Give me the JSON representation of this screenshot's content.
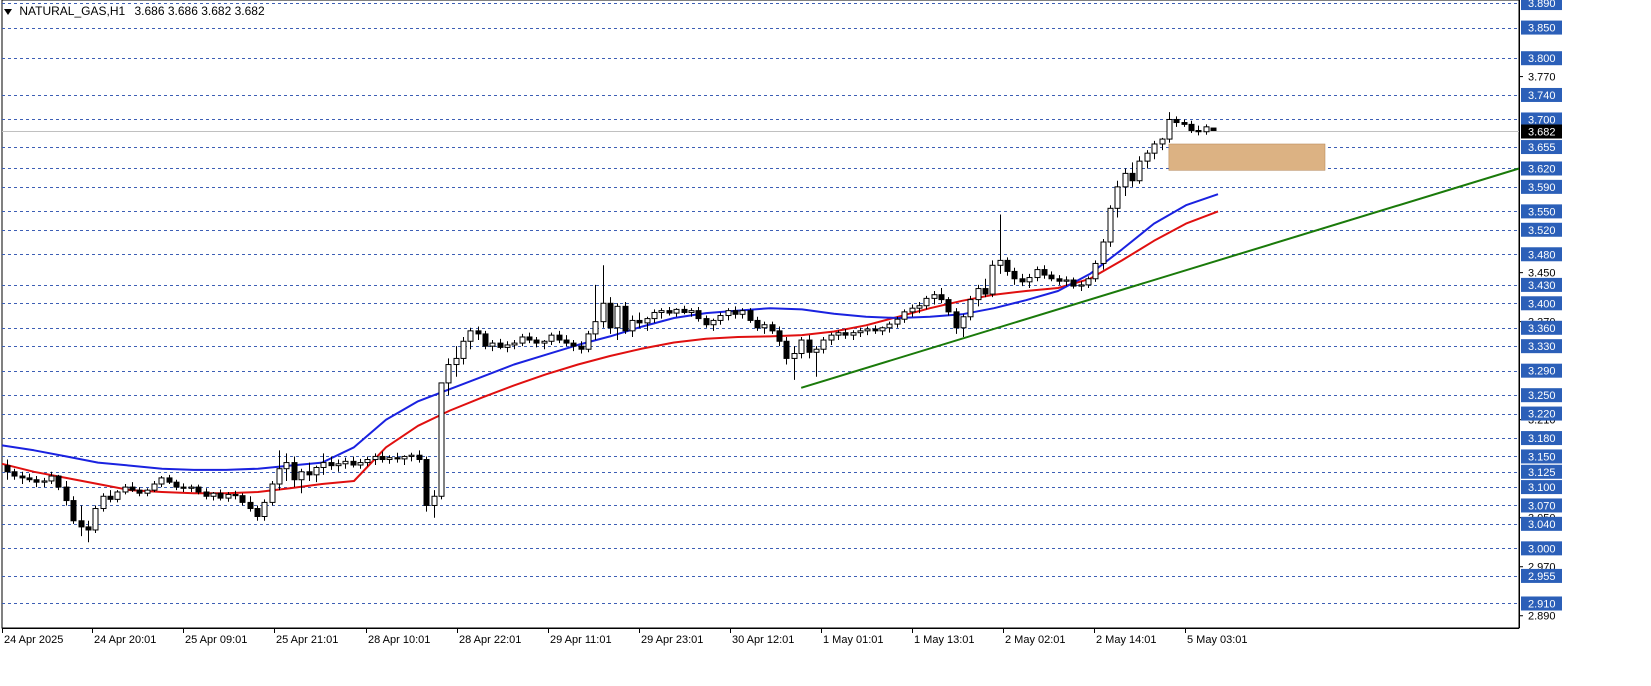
{
  "header": {
    "symbol": "NATURAL_GAS,H1",
    "ohlc": "3.686 3.686 3.682 3.682"
  },
  "colors": {
    "background": "#ffffff",
    "grid": "#3d5fb5",
    "ema_fast": "#1a22e0",
    "ema_slow": "#e01010",
    "trendline": "#1a7a0a",
    "zone": "#dcb283",
    "label_bg": "#2b5fb8",
    "current_bg": "#000000"
  },
  "chart_data": {
    "type": "candlestick",
    "ylim": [
      2.87,
      3.895
    ],
    "grid_levels": [
      3.89,
      3.85,
      3.8,
      3.74,
      3.7,
      3.655,
      3.62,
      3.59,
      3.55,
      3.52,
      3.48,
      3.43,
      3.4,
      3.36,
      3.33,
      3.29,
      3.25,
      3.22,
      3.18,
      3.15,
      3.125,
      3.1,
      3.07,
      3.04,
      3.0,
      2.955,
      2.91
    ],
    "axis_labels": [
      "3.770",
      "3.450",
      "3.370",
      "3.210",
      "3.050",
      "2.970",
      "2.890"
    ],
    "current_price": "3.682",
    "x_labels": [
      "24 Apr 2025",
      "24 Apr 20:01",
      "25 Apr 09:01",
      "25 Apr 21:01",
      "28 Apr 10:01",
      "28 Apr 22:01",
      "29 Apr 11:01",
      "29 Apr 23:01",
      "30 Apr 12:01",
      "1 May 01:01",
      "1 May 13:01",
      "2 May 02:01",
      "2 May 14:01",
      "5 May 03:01"
    ],
    "candles": [
      [
        3.135,
        3.145,
        3.112,
        3.125
      ],
      [
        3.125,
        3.13,
        3.112,
        3.118
      ],
      [
        3.118,
        3.125,
        3.105,
        3.115
      ],
      [
        3.115,
        3.122,
        3.108,
        3.112
      ],
      [
        3.112,
        3.118,
        3.1,
        3.108
      ],
      [
        3.108,
        3.115,
        3.1,
        3.11
      ],
      [
        3.11,
        3.125,
        3.105,
        3.118
      ],
      [
        3.118,
        3.12,
        3.095,
        3.1
      ],
      [
        3.1,
        3.11,
        3.07,
        3.078
      ],
      [
        3.078,
        3.085,
        3.04,
        3.045
      ],
      [
        3.045,
        3.07,
        3.02,
        3.035
      ],
      [
        3.035,
        3.045,
        3.01,
        3.03
      ],
      [
        3.03,
        3.07,
        3.025,
        3.065
      ],
      [
        3.065,
        3.09,
        3.06,
        3.085
      ],
      [
        3.085,
        3.095,
        3.075,
        3.08
      ],
      [
        3.08,
        3.095,
        3.075,
        3.092
      ],
      [
        3.092,
        3.105,
        3.088,
        3.1
      ],
      [
        3.1,
        3.108,
        3.092,
        3.095
      ],
      [
        3.095,
        3.1,
        3.085,
        3.09
      ],
      [
        3.09,
        3.098,
        3.085,
        3.095
      ],
      [
        3.095,
        3.11,
        3.092,
        3.105
      ],
      [
        3.105,
        3.118,
        3.1,
        3.115
      ],
      [
        3.115,
        3.12,
        3.105,
        3.108
      ],
      [
        3.108,
        3.112,
        3.095,
        3.1
      ],
      [
        3.1,
        3.106,
        3.092,
        3.098
      ],
      [
        3.098,
        3.104,
        3.092,
        3.1
      ],
      [
        3.1,
        3.104,
        3.088,
        3.092
      ],
      [
        3.092,
        3.098,
        3.08,
        3.085
      ],
      [
        3.085,
        3.092,
        3.078,
        3.09
      ],
      [
        3.09,
        3.096,
        3.078,
        3.082
      ],
      [
        3.082,
        3.092,
        3.076,
        3.088
      ],
      [
        3.088,
        3.094,
        3.08,
        3.086
      ],
      [
        3.086,
        3.09,
        3.07,
        3.075
      ],
      [
        3.075,
        3.085,
        3.06,
        3.065
      ],
      [
        3.065,
        3.07,
        3.045,
        3.052
      ],
      [
        3.052,
        3.08,
        3.045,
        3.075
      ],
      [
        3.075,
        3.11,
        3.07,
        3.105
      ],
      [
        3.105,
        3.16,
        3.095,
        3.13
      ],
      [
        3.13,
        3.155,
        3.11,
        3.14
      ],
      [
        3.14,
        3.15,
        3.1,
        3.112
      ],
      [
        3.112,
        3.13,
        3.09,
        3.125
      ],
      [
        3.125,
        3.14,
        3.11,
        3.12
      ],
      [
        3.12,
        3.135,
        3.108,
        3.132
      ],
      [
        3.132,
        3.155,
        3.12,
        3.14
      ],
      [
        3.14,
        3.15,
        3.128,
        3.135
      ],
      [
        3.135,
        3.145,
        3.125,
        3.138
      ],
      [
        3.138,
        3.148,
        3.13,
        3.142
      ],
      [
        3.142,
        3.15,
        3.132,
        3.136
      ],
      [
        3.136,
        3.146,
        3.13,
        3.14
      ],
      [
        3.14,
        3.15,
        3.134,
        3.145
      ],
      [
        3.145,
        3.155,
        3.136,
        3.15
      ],
      [
        3.15,
        3.158,
        3.14,
        3.145
      ],
      [
        3.145,
        3.152,
        3.138,
        3.148
      ],
      [
        3.148,
        3.156,
        3.14,
        3.146
      ],
      [
        3.146,
        3.152,
        3.136,
        3.15
      ],
      [
        3.15,
        3.156,
        3.142,
        3.152
      ],
      [
        3.152,
        3.16,
        3.14,
        3.145
      ],
      [
        3.145,
        3.15,
        3.06,
        3.07
      ],
      [
        3.07,
        3.095,
        3.05,
        3.085
      ],
      [
        3.085,
        3.26,
        3.08,
        3.27
      ],
      [
        3.27,
        3.31,
        3.25,
        3.3
      ],
      [
        3.3,
        3.33,
        3.28,
        3.31
      ],
      [
        3.31,
        3.345,
        3.3,
        3.338
      ],
      [
        3.338,
        3.36,
        3.325,
        3.355
      ],
      [
        3.355,
        3.362,
        3.34,
        3.35
      ],
      [
        3.35,
        3.355,
        3.325,
        3.33
      ],
      [
        3.33,
        3.34,
        3.322,
        3.335
      ],
      [
        3.335,
        3.342,
        3.325,
        3.328
      ],
      [
        3.328,
        3.338,
        3.32,
        3.332
      ],
      [
        3.332,
        3.34,
        3.325,
        3.335
      ],
      [
        3.335,
        3.35,
        3.33,
        3.345
      ],
      [
        3.345,
        3.352,
        3.335,
        3.34
      ],
      [
        3.34,
        3.345,
        3.328,
        3.335
      ],
      [
        3.335,
        3.34,
        3.325,
        3.338
      ],
      [
        3.338,
        3.352,
        3.332,
        3.348
      ],
      [
        3.348,
        3.355,
        3.335,
        3.34
      ],
      [
        3.34,
        3.348,
        3.33,
        3.335
      ],
      [
        3.335,
        3.34,
        3.322,
        3.33
      ],
      [
        3.33,
        3.338,
        3.318,
        3.325
      ],
      [
        3.325,
        3.355,
        3.32,
        3.35
      ],
      [
        3.35,
        3.43,
        3.34,
        3.37
      ],
      [
        3.37,
        3.462,
        3.36,
        3.4
      ],
      [
        3.4,
        3.41,
        3.35,
        3.36
      ],
      [
        3.36,
        3.4,
        3.34,
        3.395
      ],
      [
        3.395,
        3.402,
        3.35,
        3.355
      ],
      [
        3.355,
        3.38,
        3.345,
        3.372
      ],
      [
        3.372,
        3.385,
        3.36,
        3.368
      ],
      [
        3.368,
        3.378,
        3.355,
        3.375
      ],
      [
        3.375,
        3.39,
        3.368,
        3.385
      ],
      [
        3.385,
        3.392,
        3.375,
        3.388
      ],
      [
        3.388,
        3.394,
        3.38,
        3.384
      ],
      [
        3.384,
        3.392,
        3.378,
        3.39
      ],
      [
        3.39,
        3.396,
        3.382,
        3.385
      ],
      [
        3.385,
        3.392,
        3.378,
        3.388
      ],
      [
        3.388,
        3.394,
        3.37,
        3.375
      ],
      [
        3.375,
        3.38,
        3.36,
        3.365
      ],
      [
        3.365,
        3.375,
        3.355,
        3.372
      ],
      [
        3.372,
        3.385,
        3.365,
        3.38
      ],
      [
        3.38,
        3.392,
        3.372,
        3.388
      ],
      [
        3.388,
        3.395,
        3.375,
        3.382
      ],
      [
        3.382,
        3.392,
        3.375,
        3.388
      ],
      [
        3.388,
        3.392,
        3.368,
        3.372
      ],
      [
        3.372,
        3.378,
        3.355,
        3.36
      ],
      [
        3.36,
        3.37,
        3.35,
        3.365
      ],
      [
        3.365,
        3.37,
        3.35,
        3.355
      ],
      [
        3.355,
        3.362,
        3.33,
        3.338
      ],
      [
        3.338,
        3.345,
        3.3,
        3.31
      ],
      [
        3.31,
        3.33,
        3.275,
        3.318
      ],
      [
        3.318,
        3.345,
        3.31,
        3.34
      ],
      [
        3.34,
        3.348,
        3.31,
        3.32
      ],
      [
        3.32,
        3.33,
        3.28,
        3.325
      ],
      [
        3.325,
        3.345,
        3.318,
        3.34
      ],
      [
        3.34,
        3.352,
        3.332,
        3.348
      ],
      [
        3.348,
        3.356,
        3.34,
        3.352
      ],
      [
        3.352,
        3.358,
        3.342,
        3.348
      ],
      [
        3.348,
        3.356,
        3.34,
        3.352
      ],
      [
        3.352,
        3.36,
        3.345,
        3.355
      ],
      [
        3.355,
        3.362,
        3.348,
        3.358
      ],
      [
        3.358,
        3.364,
        3.35,
        3.355
      ],
      [
        3.355,
        3.362,
        3.348,
        3.36
      ],
      [
        3.36,
        3.37,
        3.352,
        3.366
      ],
      [
        3.366,
        3.378,
        3.36,
        3.374
      ],
      [
        3.374,
        3.39,
        3.368,
        3.386
      ],
      [
        3.386,
        3.398,
        3.378,
        3.392
      ],
      [
        3.392,
        3.402,
        3.384,
        3.396
      ],
      [
        3.396,
        3.412,
        3.39,
        3.408
      ],
      [
        3.408,
        3.42,
        3.398,
        3.414
      ],
      [
        3.414,
        3.425,
        3.4,
        3.406
      ],
      [
        3.406,
        3.41,
        3.38,
        3.386
      ],
      [
        3.386,
        3.392,
        3.35,
        3.36
      ],
      [
        3.36,
        3.382,
        3.345,
        3.378
      ],
      [
        3.378,
        3.412,
        3.372,
        3.406
      ],
      [
        3.406,
        3.43,
        3.395,
        3.424
      ],
      [
        3.424,
        3.44,
        3.41,
        3.415
      ],
      [
        3.415,
        3.47,
        3.41,
        3.462
      ],
      [
        3.462,
        3.545,
        3.448,
        3.47
      ],
      [
        3.47,
        3.475,
        3.445,
        3.452
      ],
      [
        3.452,
        3.458,
        3.43,
        3.44
      ],
      [
        3.44,
        3.448,
        3.428,
        3.435
      ],
      [
        3.435,
        3.448,
        3.425,
        3.442
      ],
      [
        3.442,
        3.46,
        3.436,
        3.455
      ],
      [
        3.455,
        3.462,
        3.44,
        3.446
      ],
      [
        3.446,
        3.452,
        3.436,
        3.44
      ],
      [
        3.44,
        3.446,
        3.43,
        3.436
      ],
      [
        3.436,
        3.444,
        3.428,
        3.438
      ],
      [
        3.438,
        3.442,
        3.424,
        3.428
      ],
      [
        3.428,
        3.436,
        3.42,
        3.43
      ],
      [
        3.43,
        3.444,
        3.425,
        3.44
      ],
      [
        3.44,
        3.47,
        3.435,
        3.465
      ],
      [
        3.465,
        3.505,
        3.455,
        3.5
      ],
      [
        3.5,
        3.56,
        3.492,
        3.555
      ],
      [
        3.555,
        3.6,
        3.54,
        3.59
      ],
      [
        3.59,
        3.62,
        3.575,
        3.612
      ],
      [
        3.612,
        3.63,
        3.59,
        3.6
      ],
      [
        3.6,
        3.64,
        3.595,
        3.632
      ],
      [
        3.632,
        3.65,
        3.62,
        3.645
      ],
      [
        3.645,
        3.665,
        3.635,
        3.66
      ],
      [
        3.66,
        3.67,
        3.65,
        3.668
      ],
      [
        3.668,
        3.712,
        3.662,
        3.7
      ],
      [
        3.7,
        3.705,
        3.688,
        3.695
      ],
      [
        3.695,
        3.7,
        3.688,
        3.692
      ],
      [
        3.692,
        3.698,
        3.678,
        3.682
      ],
      [
        3.682,
        3.69,
        3.674,
        3.68
      ],
      [
        3.68,
        3.692,
        3.675,
        3.688
      ],
      [
        3.686,
        3.686,
        3.682,
        3.682
      ]
    ],
    "ema_fast": [
      3.168,
      3.16,
      3.15,
      3.14,
      3.135,
      3.13,
      3.128,
      3.128,
      3.13,
      3.135,
      3.14,
      3.165,
      3.21,
      3.24,
      3.26,
      3.28,
      3.3,
      3.316,
      3.332,
      3.346,
      3.362,
      3.376,
      3.384,
      3.388,
      3.392,
      3.39,
      3.383,
      3.378,
      3.376,
      3.378,
      3.382,
      3.392,
      3.405,
      3.42,
      3.448,
      3.488,
      3.53,
      3.56,
      3.578
    ],
    "ema_slow": [
      3.138,
      3.125,
      3.115,
      3.105,
      3.095,
      3.092,
      3.09,
      3.09,
      3.092,
      3.098,
      3.105,
      3.11,
      3.165,
      3.2,
      3.225,
      3.246,
      3.266,
      3.284,
      3.3,
      3.314,
      3.326,
      3.336,
      3.342,
      3.345,
      3.346,
      3.348,
      3.354,
      3.364,
      3.378,
      3.392,
      3.404,
      3.414,
      3.42,
      3.425,
      3.44,
      3.47,
      3.502,
      3.53,
      3.55
    ],
    "trendline": {
      "from_price": 3.262,
      "to_price": 3.62
    },
    "zone": {
      "top": 3.66,
      "bottom": 3.617
    }
  }
}
